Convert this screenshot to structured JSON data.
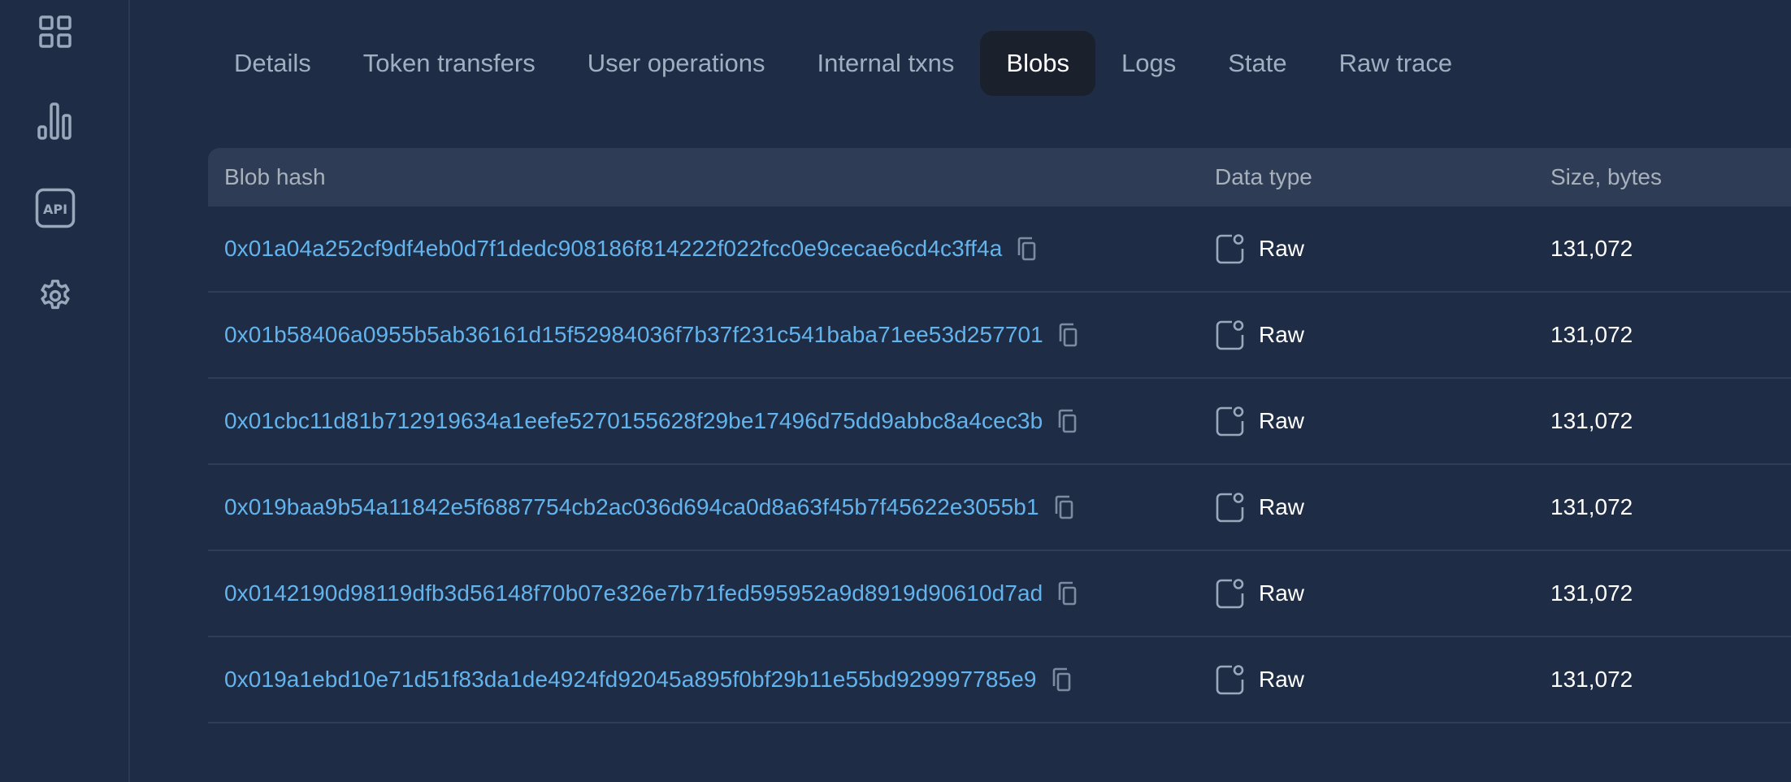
{
  "sidebar": {
    "items": [
      {
        "icon": "dashboard-grid-icon",
        "label": "Dashboard"
      },
      {
        "icon": "stats-chart-icon",
        "label": "Stats"
      },
      {
        "icon": "api-icon",
        "label": "API"
      },
      {
        "icon": "gear-icon",
        "label": "Settings"
      }
    ]
  },
  "tabs": [
    {
      "label": "Details",
      "active": false
    },
    {
      "label": "Token transfers",
      "active": false
    },
    {
      "label": "User operations",
      "active": false
    },
    {
      "label": "Internal txns",
      "active": false
    },
    {
      "label": "Blobs",
      "active": true
    },
    {
      "label": "Logs",
      "active": false
    },
    {
      "label": "State",
      "active": false
    },
    {
      "label": "Raw trace",
      "active": false
    }
  ],
  "table": {
    "headers": {
      "blob_hash": "Blob hash",
      "data_type": "Data type",
      "size": "Size, bytes"
    },
    "rows": [
      {
        "hash": "0x01a04a252cf9df4eb0d7f1dedc908186f814222f022fcc0e9cecae6cd4c3ff4a",
        "data_type": "Raw",
        "size": "131,072"
      },
      {
        "hash": "0x01b58406a0955b5ab36161d15f52984036f7b37f231c541baba71ee53d257701",
        "data_type": "Raw",
        "size": "131,072"
      },
      {
        "hash": "0x01cbc11d81b712919634a1eefe5270155628f29be17496d75dd9abbc8a4cec3b",
        "data_type": "Raw",
        "size": "131,072"
      },
      {
        "hash": "0x019baa9b54a11842e5f6887754cb2ac036d694ca0d8a63f45b7f45622e3055b1",
        "data_type": "Raw",
        "size": "131,072"
      },
      {
        "hash": "0x0142190d98119dfb3d56148f70b07e326e7b71fed595952a9d8919d90610d7ad",
        "data_type": "Raw",
        "size": "131,072"
      },
      {
        "hash": "0x019a1ebd10e71d51f83da1de4924fd92045a895f0bf29b11e55bd929997785e9",
        "data_type": "Raw",
        "size": "131,072"
      }
    ]
  },
  "colors": {
    "background": "#1e2d45",
    "header_bg": "#2e3d55",
    "active_tab_bg": "#1a202c",
    "link": "#63b3ed",
    "muted_text": "#a0aec0",
    "icon": "#8a9bb2"
  }
}
